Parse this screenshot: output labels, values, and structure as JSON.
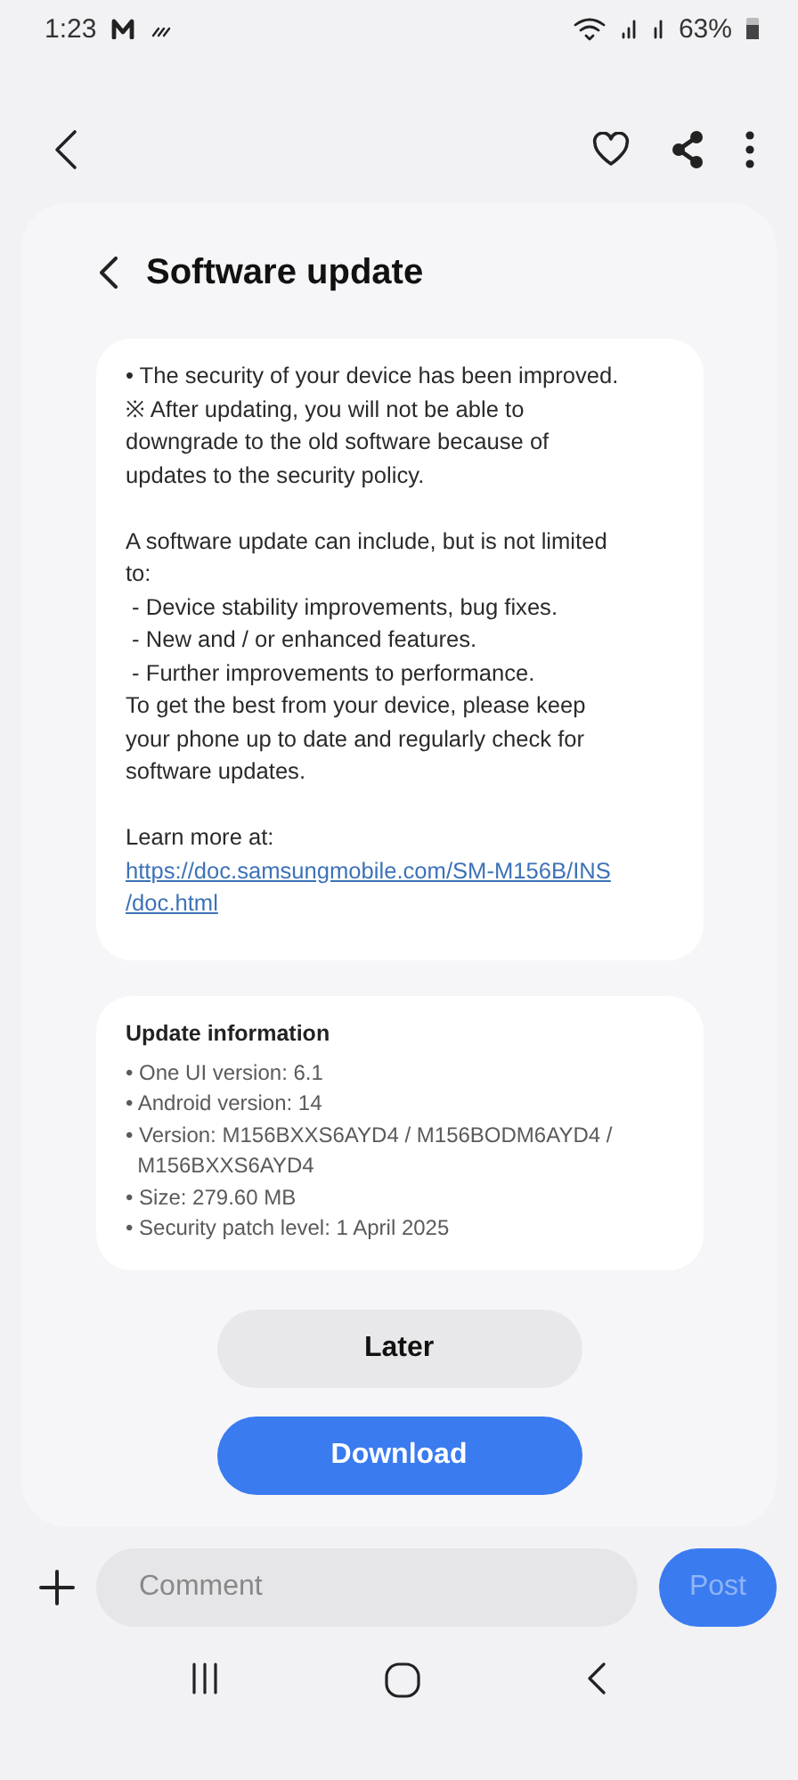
{
  "status_bar": {
    "time": "1:23",
    "battery": "63%"
  },
  "page": {
    "title": "Software update"
  },
  "notes": {
    "paragraphs": [
      [
        "• The security of your device has been improved.",
        "※ After updating, you will not be able to",
        "downgrade to the old software because of",
        "updates to the security policy."
      ],
      [
        "A software update can include, but is not limited",
        "to:",
        " - Device stability improvements, bug fixes.",
        " - New and / or enhanced features.",
        " - Further improvements to performance.",
        "To get the best from your device, please keep",
        "your phone up to date and regularly check for",
        "software updates."
      ],
      [
        "Learn more at:"
      ]
    ],
    "link": [
      "https://doc.samsungmobile.com/SM-M156B/INS",
      "/doc.html"
    ]
  },
  "update_info": {
    "title": "Update information",
    "items": [
      [
        "• One UI version: 6.1"
      ],
      [
        "• Android version: 14"
      ],
      [
        "• Version: M156BXXS6AYD4 / M156BODM6AYD4 /",
        "  M156BXXS6AYD4"
      ],
      [
        "• Size: 279.60 MB"
      ],
      [
        "• Security patch level: 1 April 2025"
      ]
    ]
  },
  "buttons": [
    {
      "label": "Later",
      "kind": "secondary"
    },
    {
      "label": "Download",
      "kind": "primary"
    }
  ],
  "comment": {
    "placeholder": "Comment",
    "post": "Post"
  }
}
